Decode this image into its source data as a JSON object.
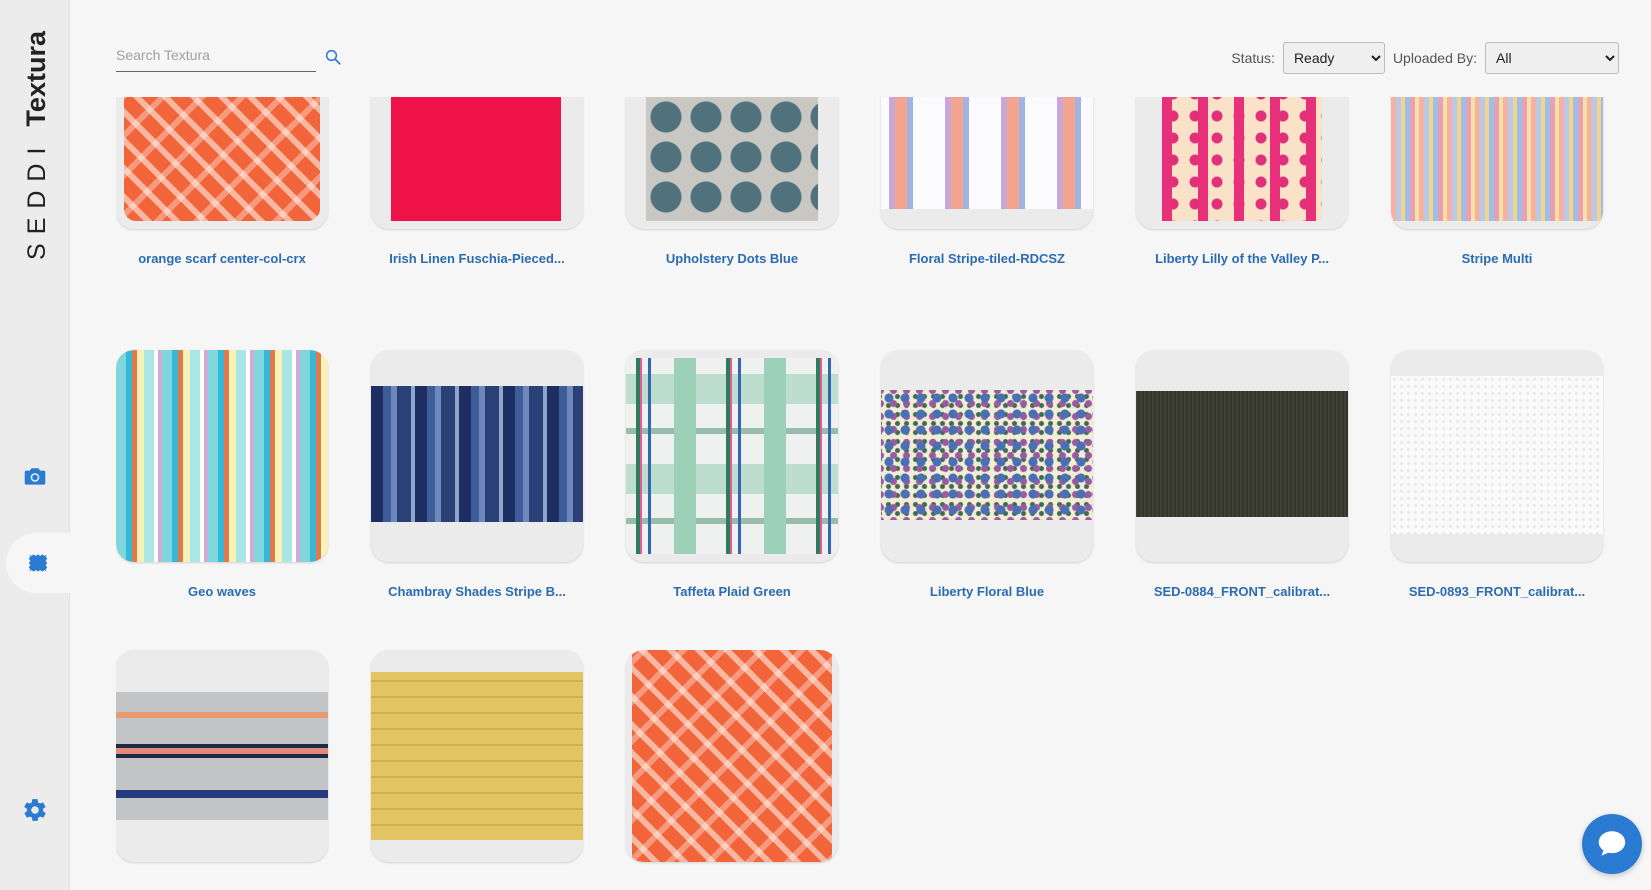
{
  "app": {
    "brand_prefix": "SEDDI",
    "brand_name": "Textura"
  },
  "search": {
    "placeholder": "Search Textura",
    "value": ""
  },
  "filters": {
    "status_label": "Status:",
    "status_value": "Ready",
    "uploaded_label": "Uploaded By:",
    "uploaded_value": "All"
  },
  "items": [
    {
      "title": "orange scarf center-col-crx",
      "thumb": "orange-diamond-weave"
    },
    {
      "title": "Irish Linen Fuschia-Pieced...",
      "thumb": "fuschia-linen"
    },
    {
      "title": "Upholstery Dots Blue",
      "thumb": "blue-dots"
    },
    {
      "title": "Floral Stripe-tiled-RDCSZ",
      "thumb": "floral-stripe"
    },
    {
      "title": "Liberty Lilly of the Valley P...",
      "thumb": "pink-vine"
    },
    {
      "title": "Stripe Multi",
      "thumb": "multi-stripe"
    },
    {
      "title": "Geo waves",
      "thumb": "geo-waves"
    },
    {
      "title": "Chambray Shades Stripe B...",
      "thumb": "chambray-stripe"
    },
    {
      "title": "Taffeta Plaid Green",
      "thumb": "green-plaid"
    },
    {
      "title": "Liberty Floral Blue",
      "thumb": "blue-floral"
    },
    {
      "title": "SED-0884_FRONT_calibrat...",
      "thumb": "dark-knit"
    },
    {
      "title": "SED-0893_FRONT_calibrat...",
      "thumb": "white-texture"
    },
    {
      "title": "",
      "thumb": "fair-isle-knit"
    },
    {
      "title": "",
      "thumb": "yellow-crinkle"
    },
    {
      "title": "",
      "thumb": "orange-diamond-weave"
    }
  ],
  "colors": {
    "accent": "#2b6cb0",
    "chat": "#2a7bd1",
    "nav_icon": "#2a7bd1"
  }
}
